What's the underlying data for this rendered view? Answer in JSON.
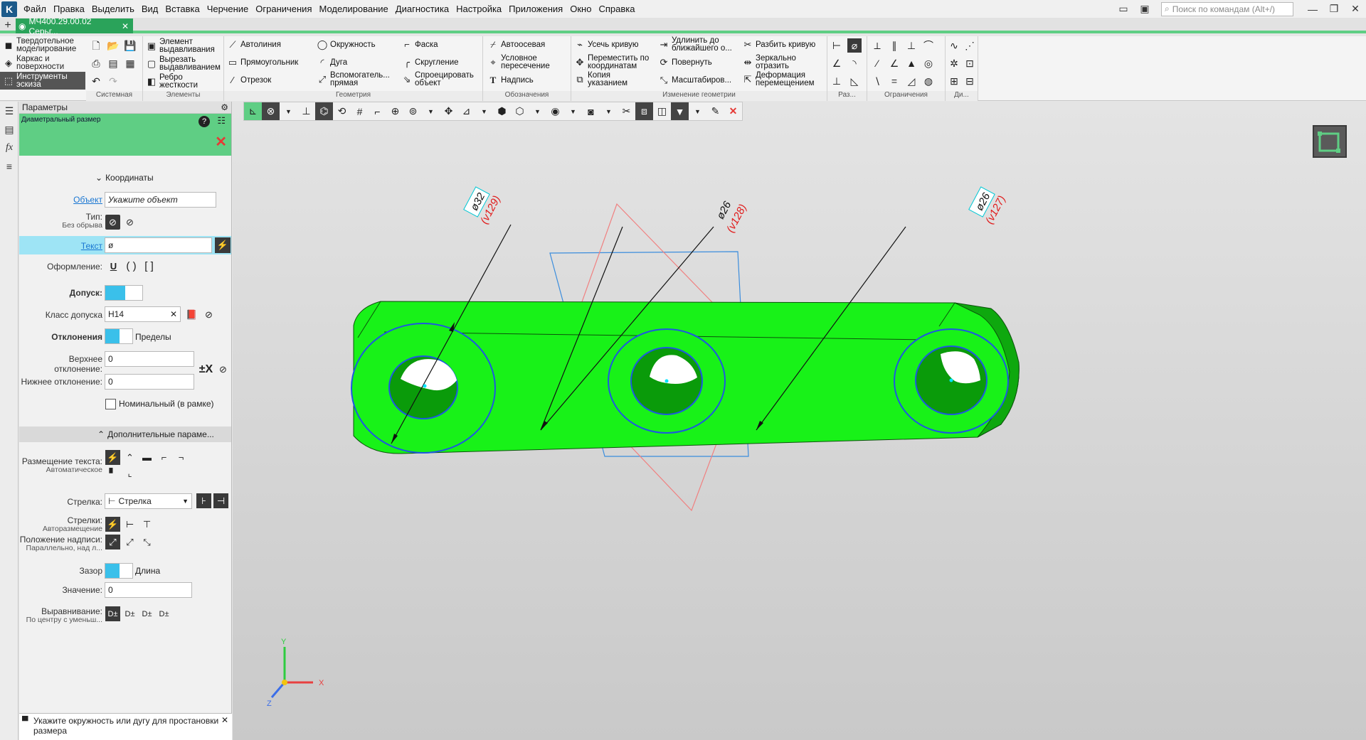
{
  "menu": {
    "items": [
      "Файл",
      "Правка",
      "Выделить",
      "Вид",
      "Вставка",
      "Черчение",
      "Ограничения",
      "Моделирование",
      "Диагностика",
      "Настройка",
      "Приложения",
      "Окно",
      "Справка"
    ],
    "search_placeholder": "Поиск по командам (Alt+/)"
  },
  "doc_tab": {
    "title": "МЧ400.29.00.02 Серьг...",
    "close": "✕"
  },
  "ribbon": {
    "modes": [
      "Твердотельное моделирование",
      "Каркас и поверхности",
      "Инструменты эскиза"
    ],
    "group_labels": [
      "Системная",
      "Элементы",
      "Геометрия",
      "Обозначения",
      "Изменение геометрии",
      "Раз...",
      "Ограничения",
      "Ди..."
    ],
    "elements": [
      "Элемент выдавливания",
      "Вырезать выдавливанием",
      "Ребро жесткости"
    ],
    "geometry": [
      "Автолиния",
      "Прямоугольник",
      "Отрезок",
      "Окружность",
      "Дуга",
      "Вспомогатель... прямая",
      "Фаска",
      "Скругление",
      "Спроецировать объект"
    ],
    "annotations": [
      "Автоосевая",
      "Условное пересечение",
      "Надпись"
    ],
    "modify": [
      "Усечь кривую",
      "Переместить по координатам",
      "Копия указанием",
      "Удлинить до ближайшего о...",
      "Повернуть",
      "Масштабиров...",
      "Разбить кривую",
      "Зеркально отразить",
      "Деформация перемещением"
    ]
  },
  "panel": {
    "header": "Параметры",
    "title": "Диаметральный размер",
    "coords_section": "Координаты",
    "object_label": "Объект",
    "object_placeholder": "Укажите объект",
    "type_label": "Тип:",
    "type_value": "Без обрыва",
    "text_label": "Текст",
    "text_value": "ø",
    "formatting_label": "Оформление:",
    "formatting_options": [
      "U",
      "( )",
      "[ ]"
    ],
    "tolerance_label": "Допуск:",
    "class_label": "Класс допуска",
    "class_value": "H14",
    "deviations_label": "Отклонения",
    "limits_label": "Пределы",
    "upper_label": "Верхнее отклонение:",
    "upper_value": "0",
    "lower_label": "Нижнее отклонение:",
    "lower_value": "0",
    "nominal_label": "Номинальный (в рамке)",
    "extra_section": "Дополнительные параме...",
    "text_place_label": "Размещение текста:",
    "text_place_value": "Автоматическое",
    "arrow_label": "Стрелка:",
    "arrow_value": "Стрелка",
    "arrows_label": "Стрелки:",
    "arrows_value": "Авторазмещение",
    "caption_label": "Положение надписи:",
    "caption_value": "Параллельно, над л...",
    "gap_label": "Зазор",
    "length_label": "Длина",
    "value_label": "Значение:",
    "value_value": "0",
    "align_label": "Выравнивание:",
    "align_value": "По центру с уменьш...",
    "status_message": "Укажите окружность или дугу для простановки размера"
  },
  "dims": [
    {
      "text": "ø32",
      "ref": "(v129)"
    },
    {
      "text": "ø26",
      "ref": "(v128)"
    },
    {
      "text": "ø26",
      "ref": "(v127)"
    }
  ],
  "axes": {
    "x": "X",
    "y": "Y",
    "z": "Z"
  },
  "colors": {
    "part": "#18f218",
    "part_dark": "#0ea80e",
    "accent": "#2aa35a",
    "header_green": "#5fce84",
    "circle": "#1e58e0",
    "dim_ref": "#e01818"
  }
}
